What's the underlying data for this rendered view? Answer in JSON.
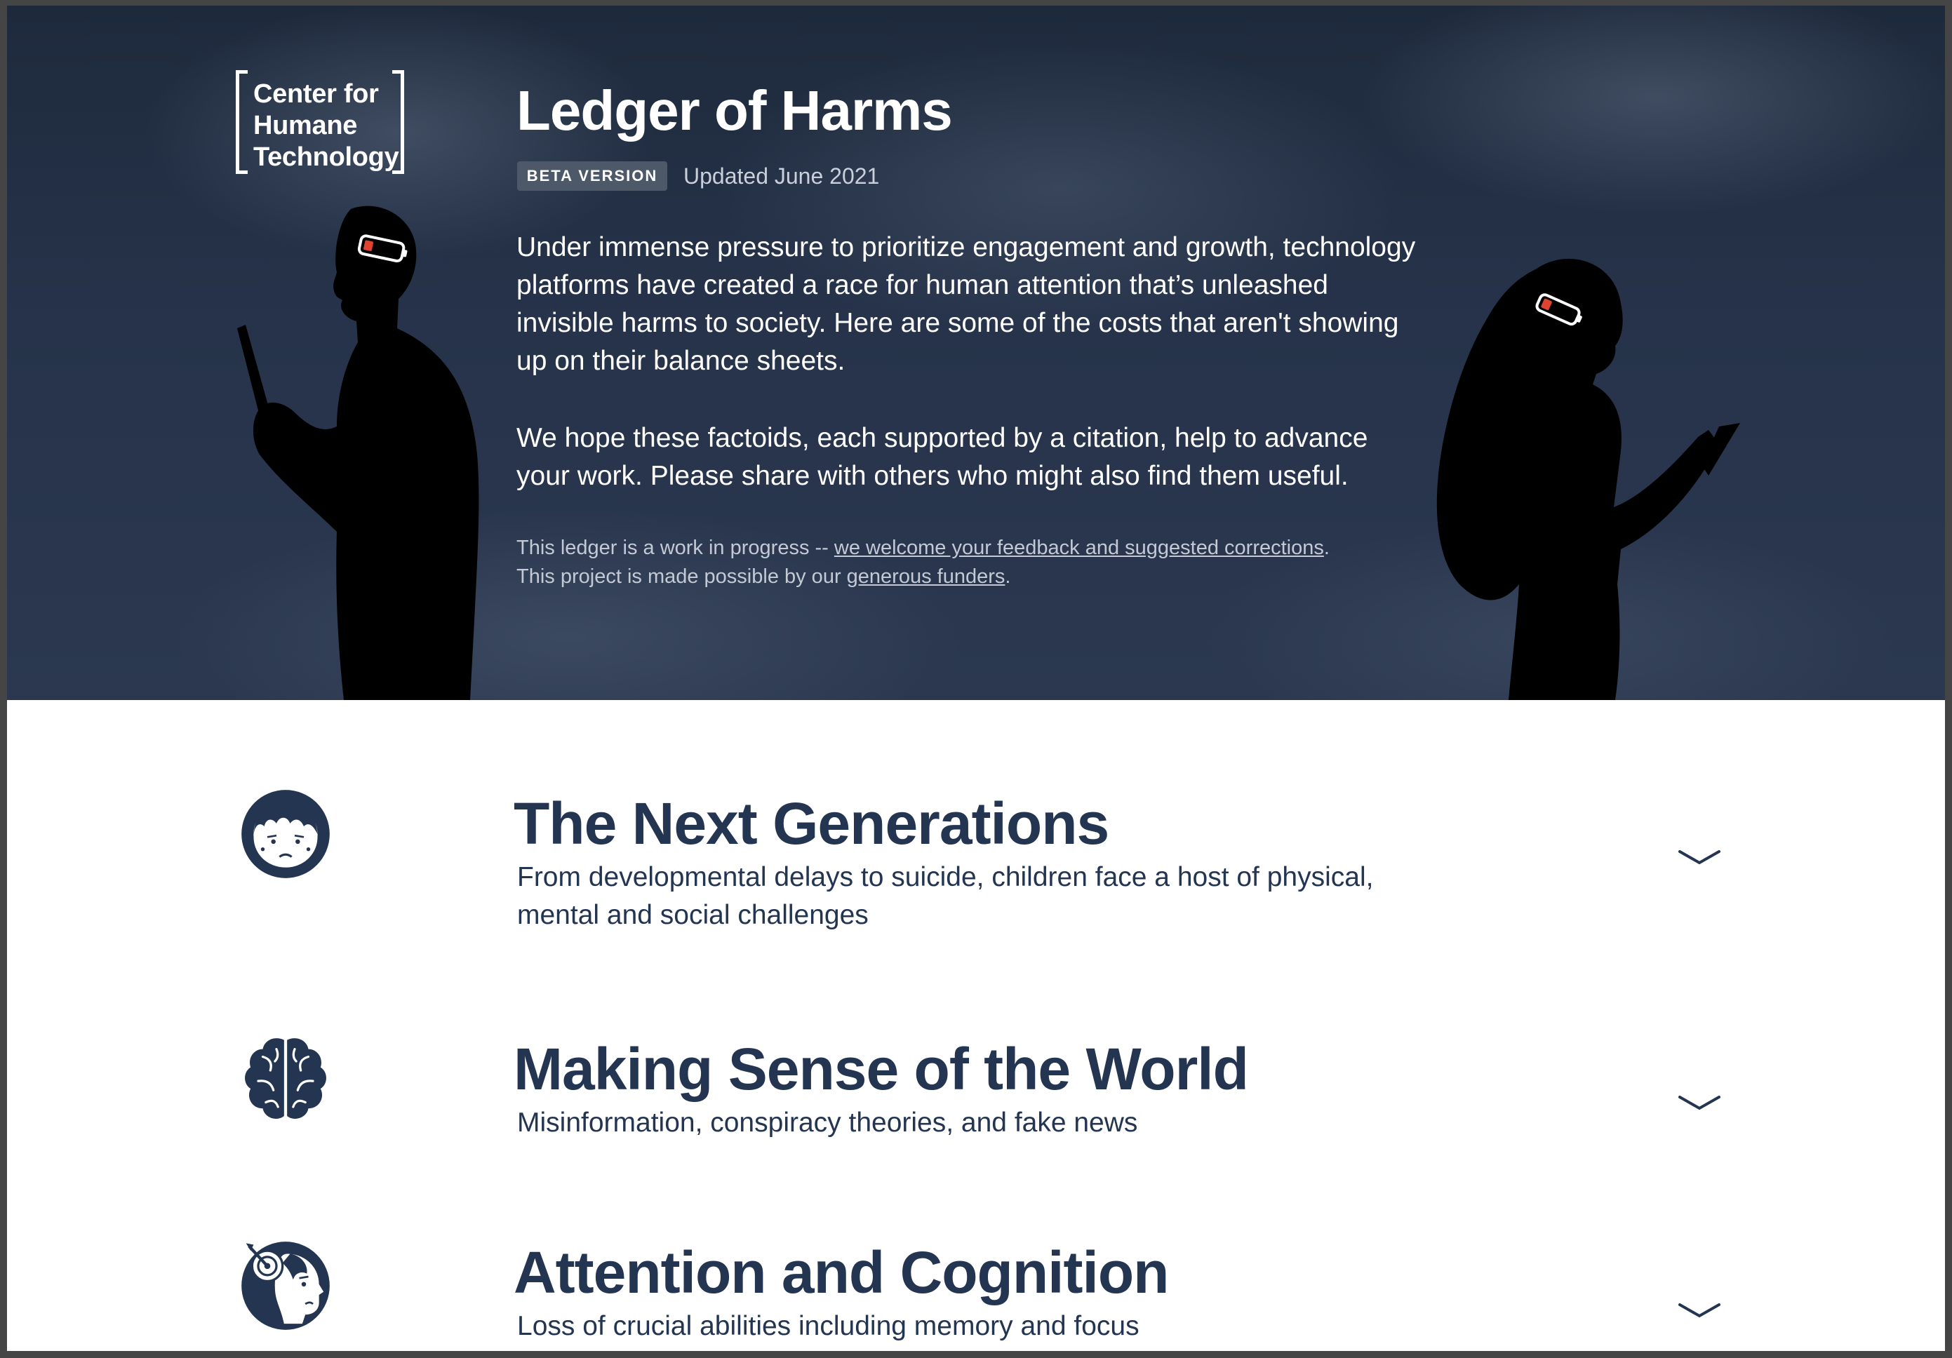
{
  "hero": {
    "logo_lines": [
      "Center for",
      "Humane",
      "Technology"
    ],
    "title": "Ledger of Harms",
    "badge": "BETA VERSION",
    "updated": "Updated June 2021",
    "intro_1": "Under immense pressure to prioritize engagement and growth, technology platforms have created a race for human attention that’s unleashed invisible harms to society. Here are some of the costs that aren't showing up on their balance sheets.",
    "intro_2": "We hope these factoids, each supported by a citation, help to advance your work. Please share with others who might also find them useful.",
    "fine_1_prefix": "This ledger is a work in progress -- ",
    "fine_1_link": "we welcome your feedback and suggested corrections",
    "fine_1_suffix": ".",
    "fine_2_prefix": "This project is made possible by our ",
    "fine_2_link": "generous funders",
    "fine_2_suffix": "."
  },
  "sections": [
    {
      "icon": "child-face-icon",
      "title": "The Next Generations",
      "description": "From developmental delays to suicide, children face a host of physical, mental and social challenges"
    },
    {
      "icon": "brain-icon",
      "title": "Making Sense of the World",
      "description": "Misinformation, conspiracy theories, and fake news"
    },
    {
      "icon": "head-target-icon",
      "title": "Attention and Cognition",
      "description": "Loss of crucial abilities including memory and focus"
    }
  ],
  "colors": {
    "hero_bg": "#26334a",
    "accent": "#243552",
    "battery_low": "#e0432f"
  }
}
